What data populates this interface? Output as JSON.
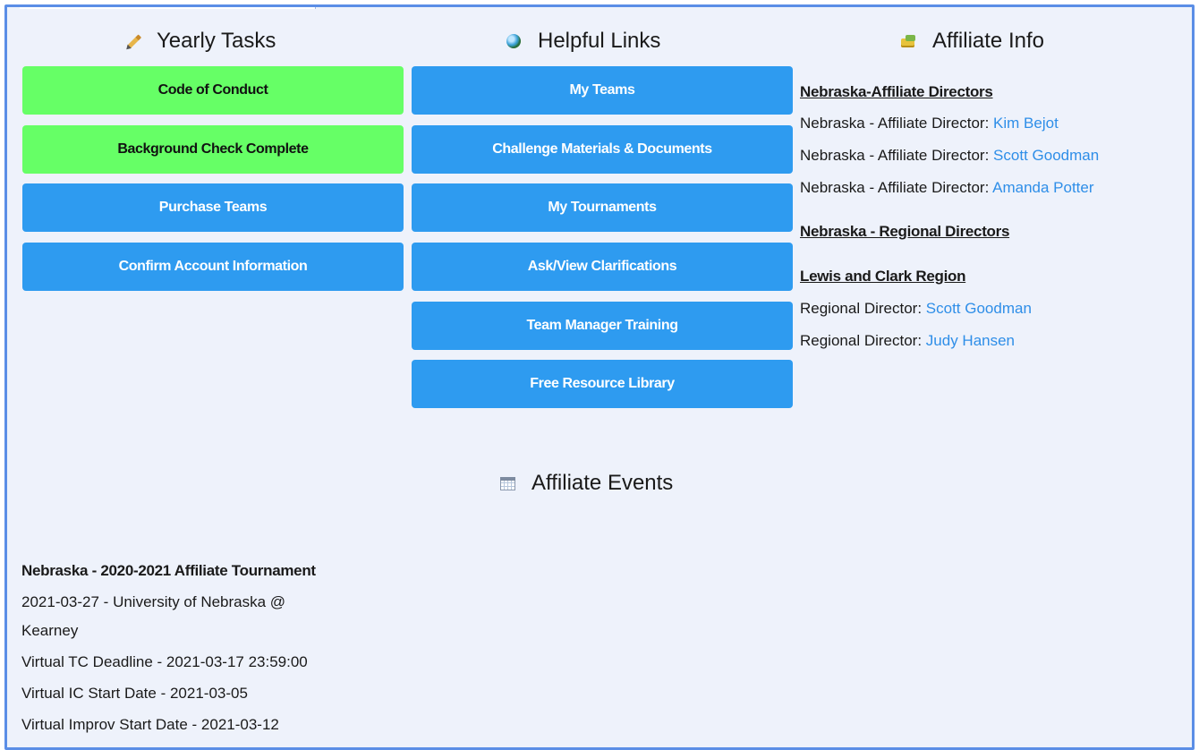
{
  "yearly_tasks": {
    "heading": "Yearly Tasks",
    "buttons": [
      {
        "label": "Code of Conduct",
        "state": "complete"
      },
      {
        "label": "Background Check Complete",
        "state": "complete"
      },
      {
        "label": "Purchase Teams",
        "state": "action"
      },
      {
        "label": "Confirm Account Information",
        "state": "action"
      }
    ]
  },
  "helpful_links": {
    "heading": "Helpful Links",
    "buttons": [
      {
        "label": "My Teams"
      },
      {
        "label": "Challenge Materials & Documents"
      },
      {
        "label": "My Tournaments"
      },
      {
        "label": "Ask/View Clarifications"
      },
      {
        "label": "Team Manager Training"
      },
      {
        "label": "Free Resource Library"
      }
    ]
  },
  "affiliate_info": {
    "heading": "Affiliate Info",
    "affiliate_directors_heading": "Nebraska-Affiliate Directors",
    "affiliate_directors": [
      {
        "role": "Nebraska - Affiliate Director: ",
        "name": "Kim Bejot"
      },
      {
        "role": "Nebraska - Affiliate Director: ",
        "name": "Scott Goodman"
      },
      {
        "role": "Nebraska - Affiliate Director: ",
        "name": "Amanda Potter"
      }
    ],
    "regional_directors_heading": "Nebraska - Regional Directors",
    "region_name": "Lewis and Clark Region",
    "regional_directors": [
      {
        "role": "Regional Director: ",
        "name": "Scott Goodman"
      },
      {
        "role": "Regional Director: ",
        "name": "Judy Hansen"
      }
    ]
  },
  "affiliate_events": {
    "heading": "Affiliate Events",
    "event": {
      "title": "Nebraska - 2020-2021 Affiliate Tournament",
      "date_line_1": "2021-03-27 - University of Nebraska @",
      "date_line_2": "Kearney",
      "tc_deadline": "Virtual TC Deadline - 2021-03-17 23:59:00",
      "ic_start": "Virtual IC Start Date - 2021-03-05",
      "improv_start": "Virtual Improv Start Date - 2021-03-12"
    }
  },
  "colors": {
    "complete_button": "#66ff66",
    "action_button": "#2e9bf0",
    "link": "#2e8ee8",
    "border": "#5b8ee6",
    "background": "#eef2fb"
  },
  "icons": {
    "yearly_tasks": "pencil-icon",
    "helpful_links": "globe-icon",
    "affiliate_info": "folder-icon",
    "affiliate_events": "calendar-icon"
  }
}
